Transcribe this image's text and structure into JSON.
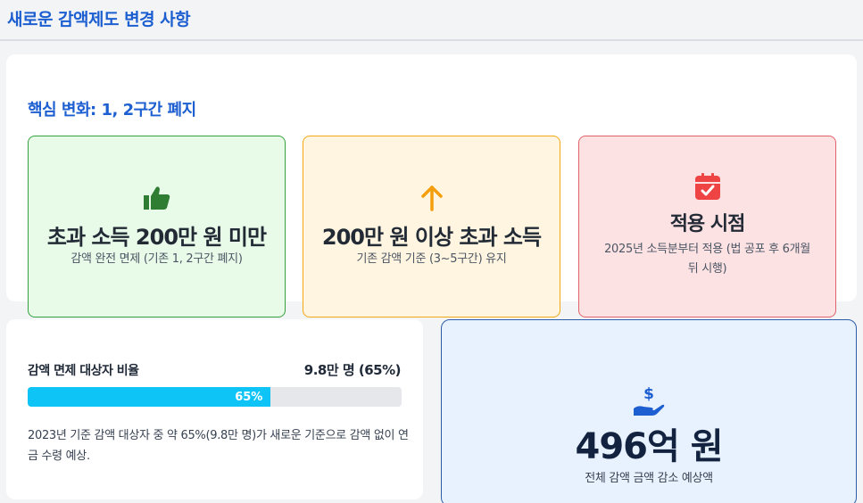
{
  "header": {
    "title": "새로운 감액제도 변경 사항"
  },
  "section": {
    "title": "핵심 변화: 1, 2구간 폐지"
  },
  "cards": [
    {
      "icon": "thumbs-up-icon",
      "title": "초과 소득 200만 원 미만",
      "desc": "감액 완전 면제 (기존 1, 2구간 폐지)",
      "accent": "#2e7d32"
    },
    {
      "icon": "arrow-up-icon",
      "title": "200만 원 이상 초과 소득",
      "desc": "기존 감액 기준 (3~5구간) 유지",
      "accent": "#f59e0b"
    },
    {
      "icon": "calendar-check-icon",
      "title": "적용 시점",
      "desc": "2025년 소득분부터 적용 (법 공포 후 6개월 뒤 시행)",
      "accent": "#ef4444"
    }
  ],
  "ratio": {
    "label": "감액 면제 대상자 비율",
    "value": "9.8만 명 (65%)",
    "progress_percent": 65,
    "progress_label": "65%",
    "note": "2023년 기준 감액 대상자 중 약 65%(9.8만 명)가 새로운 기준으로 감액 없이 연금 수령 예상."
  },
  "total": {
    "icon": "hand-dollar-icon",
    "value": "496억 원",
    "caption": "전체 감액 금액 감소 예상액"
  },
  "colors": {
    "brand_blue": "#1d5fd0",
    "progress": "#0ec4f7",
    "total_bg": "#e8f1fe"
  }
}
